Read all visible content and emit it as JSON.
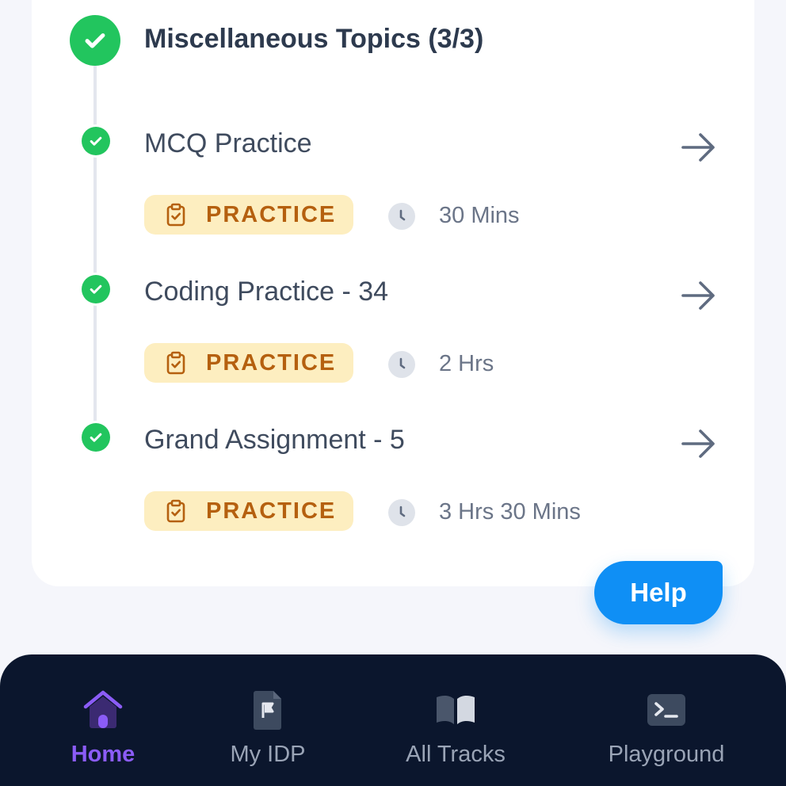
{
  "section": {
    "title": "Miscellaneous Topics (3/3)"
  },
  "items": [
    {
      "title": "MCQ Practice",
      "badge": "PRACTICE",
      "duration": "30 Mins"
    },
    {
      "title": "Coding Practice - 34",
      "badge": "PRACTICE",
      "duration": "2 Hrs"
    },
    {
      "title": "Grand Assignment - 5",
      "badge": "PRACTICE",
      "duration": "3 Hrs 30 Mins"
    }
  ],
  "help": {
    "label": "Help"
  },
  "nav": {
    "items": [
      {
        "label": "Home",
        "icon": "home-icon",
        "active": true
      },
      {
        "label": "My IDP",
        "icon": "flag-document-icon",
        "active": false
      },
      {
        "label": "All Tracks",
        "icon": "book-icon",
        "active": false
      },
      {
        "label": "Playground",
        "icon": "terminal-icon",
        "active": false
      }
    ]
  },
  "colors": {
    "success": "#22c55e",
    "badge_bg": "#fdeec0",
    "badge_text": "#b5600f",
    "help_bg": "#0f8ff5",
    "nav_bg": "#0b162d",
    "nav_active": "#8b5cf6"
  }
}
